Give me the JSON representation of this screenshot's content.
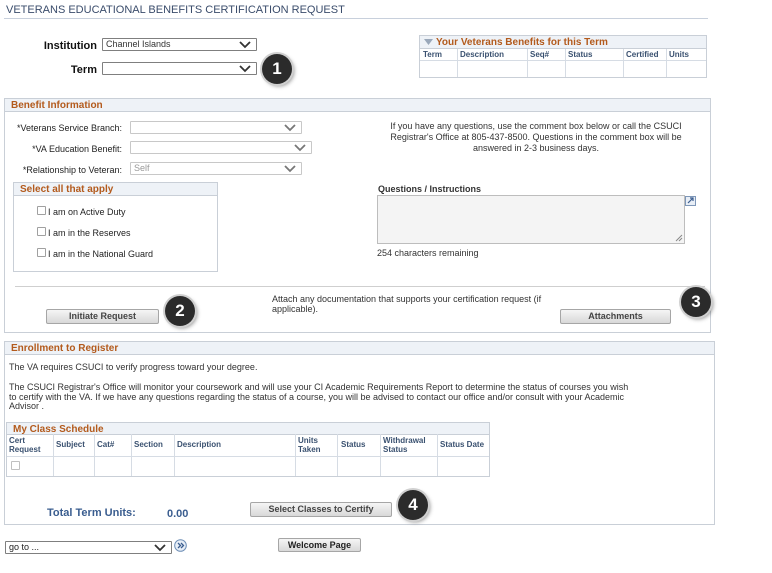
{
  "page": {
    "title": "VETERANS EDUCATIONAL BENEFITS CERTIFICATION REQUEST"
  },
  "header_form": {
    "institution_label": "Institution",
    "institution_value": "Channel Islands",
    "term_label": "Term",
    "term_value": ""
  },
  "benefits_panel": {
    "title": "Your Veterans Benefits for this Term",
    "columns": [
      "Term",
      "Description",
      "Seq#",
      "Status",
      "Certified",
      "Units"
    ]
  },
  "benefit_info": {
    "title": "Benefit Information",
    "service_branch_label": "*Veterans Service Branch:",
    "service_branch_value": "",
    "va_benefit_label": "*VA Education Benefit:",
    "va_benefit_value": "",
    "relationship_label": "*Relationship to Veteran:",
    "relationship_value": "Self",
    "help_text": "If you have any questions, use the comment box below or call the CSUCI Registrar's Office at 805-437-8500. Questions in the comment box will be answered in 2-3 business days.",
    "select_all_title": "Select all that apply",
    "options": [
      "I am on Active Duty",
      "I am in the Reserves",
      "I am in the National Guard"
    ],
    "questions_label": "Questions / Instructions",
    "chars_remaining": "254 characters remaining",
    "attach_text": "Attach any documentation that supports your certification request (if applicable).",
    "initiate_button": "Initiate Request",
    "attachments_button": "Attachments"
  },
  "enrollment": {
    "title": "Enrollment to Register",
    "line1": "The VA requires CSUCI to verify progress toward your degree.",
    "line2": "The CSUCI Registrar's Office will monitor your coursework and will use your CI Academic Requirements Report to determine the status of courses you wish to certify with the VA. If we have any questions regarding the status of a course, you will be advised to contact our office and/or consult with your Academic Advisor .",
    "schedule_title": "My Class  Schedule",
    "columns": [
      "Cert Request",
      "Subject",
      "Cat#",
      "Section",
      "Description",
      "Units Taken",
      "Status",
      "Withdrawal Status",
      "Status Date"
    ],
    "total_label": "Total Term Units:",
    "total_value": "0.00",
    "select_classes_button": "Select Classes to Certify"
  },
  "footer": {
    "goto_value": "go to ...",
    "welcome_button": "Welcome Page"
  },
  "badges": [
    "1",
    "2",
    "3",
    "4"
  ],
  "colors": {
    "accent_orange": "#b35a1c",
    "title_blue": "#3a4c6b",
    "total_blue": "#3a5d8f",
    "badge": "#2b2b2b"
  }
}
